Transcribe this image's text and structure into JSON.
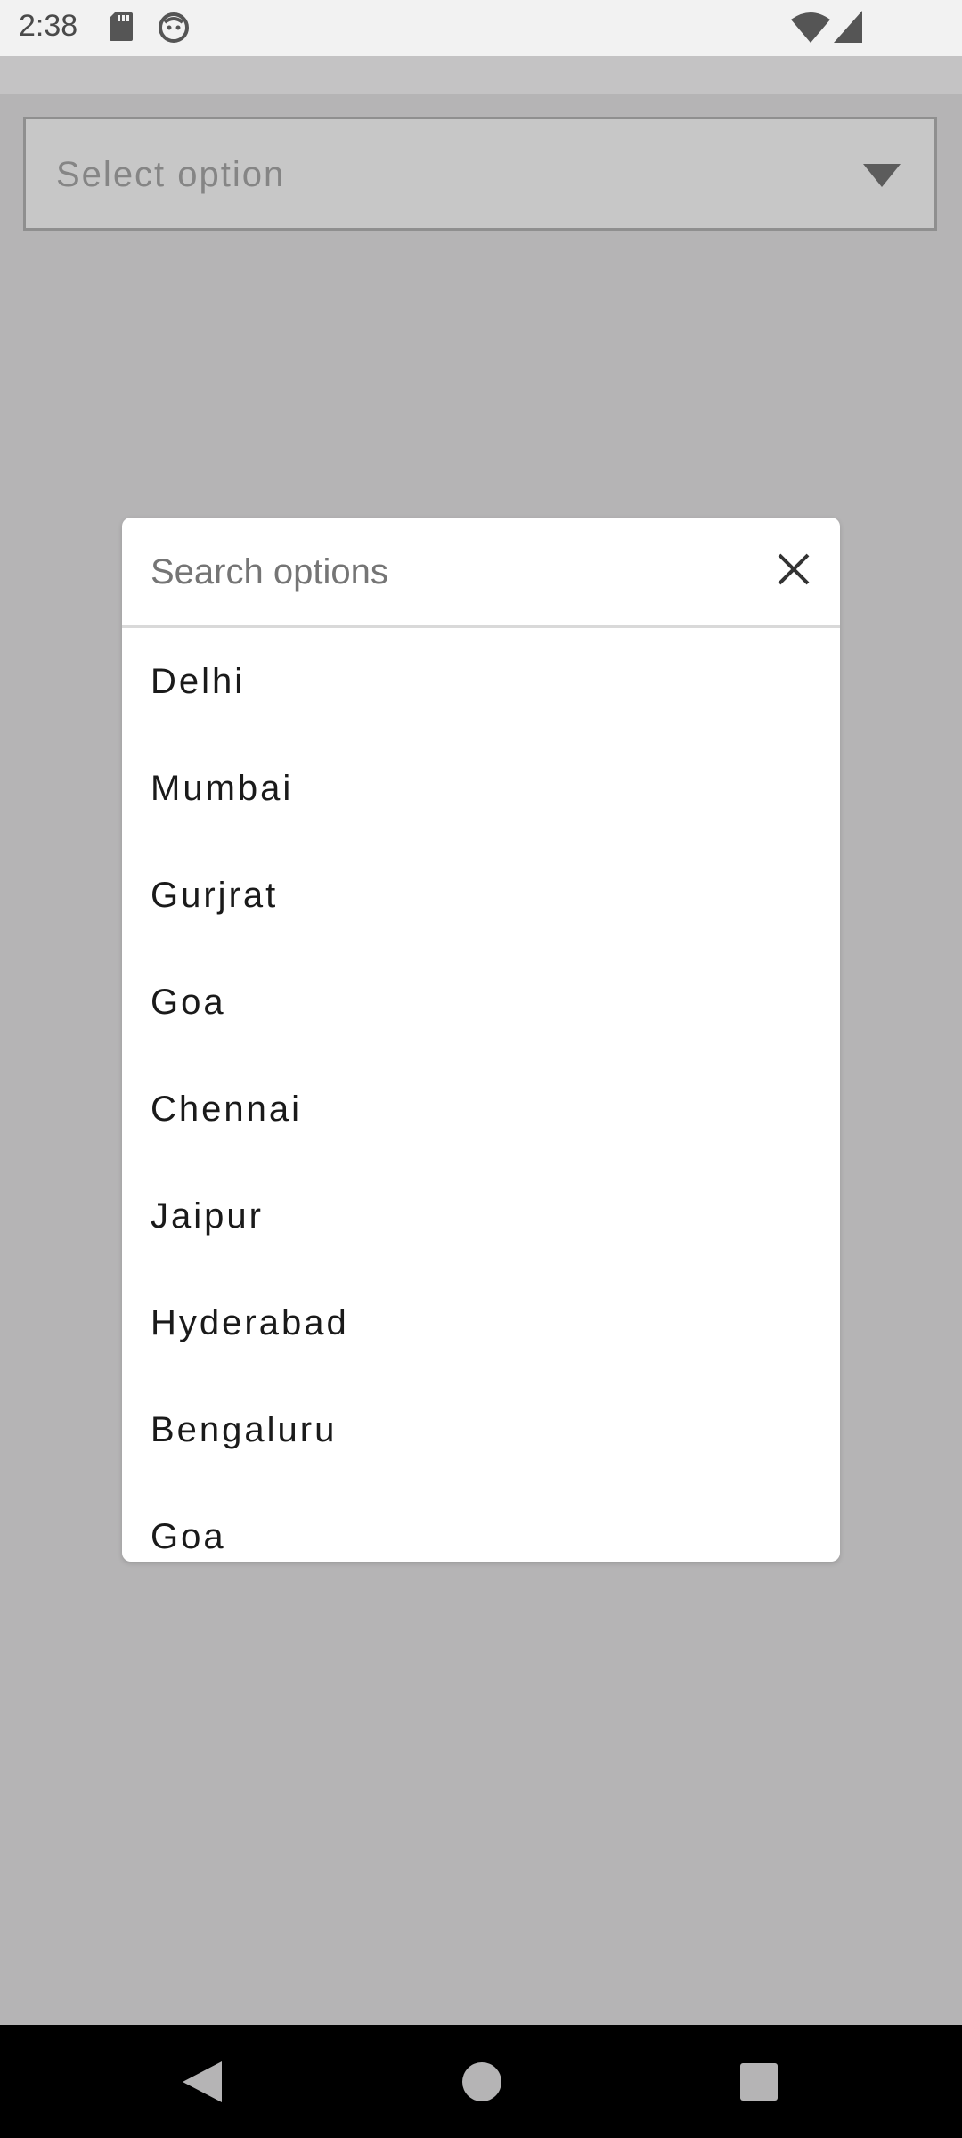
{
  "status_bar": {
    "time": "2:38",
    "icons": [
      "sd-card-icon",
      "android-face-icon",
      "wifi-icon",
      "signal-icon"
    ]
  },
  "select": {
    "placeholder": "Select option",
    "arrow_icon": "dropdown-arrow-icon"
  },
  "dialog": {
    "search_placeholder": "Search options",
    "close_icon": "close-icon",
    "options": [
      {
        "label": "Delhi"
      },
      {
        "label": "Mumbai"
      },
      {
        "label": "Gurjrat"
      },
      {
        "label": "Goa"
      },
      {
        "label": "Chennai"
      },
      {
        "label": "Jaipur"
      },
      {
        "label": "Hyderabad"
      },
      {
        "label": "Bengaluru"
      },
      {
        "label": "Goa"
      }
    ]
  },
  "nav_bar": {
    "buttons": [
      "back-icon",
      "home-icon",
      "recents-icon"
    ]
  },
  "colors": {
    "scrim": "#b5b4b5",
    "dialog_bg": "#ffffff",
    "nav_bg": "#000000",
    "status_bg": "#f2f2f2"
  }
}
